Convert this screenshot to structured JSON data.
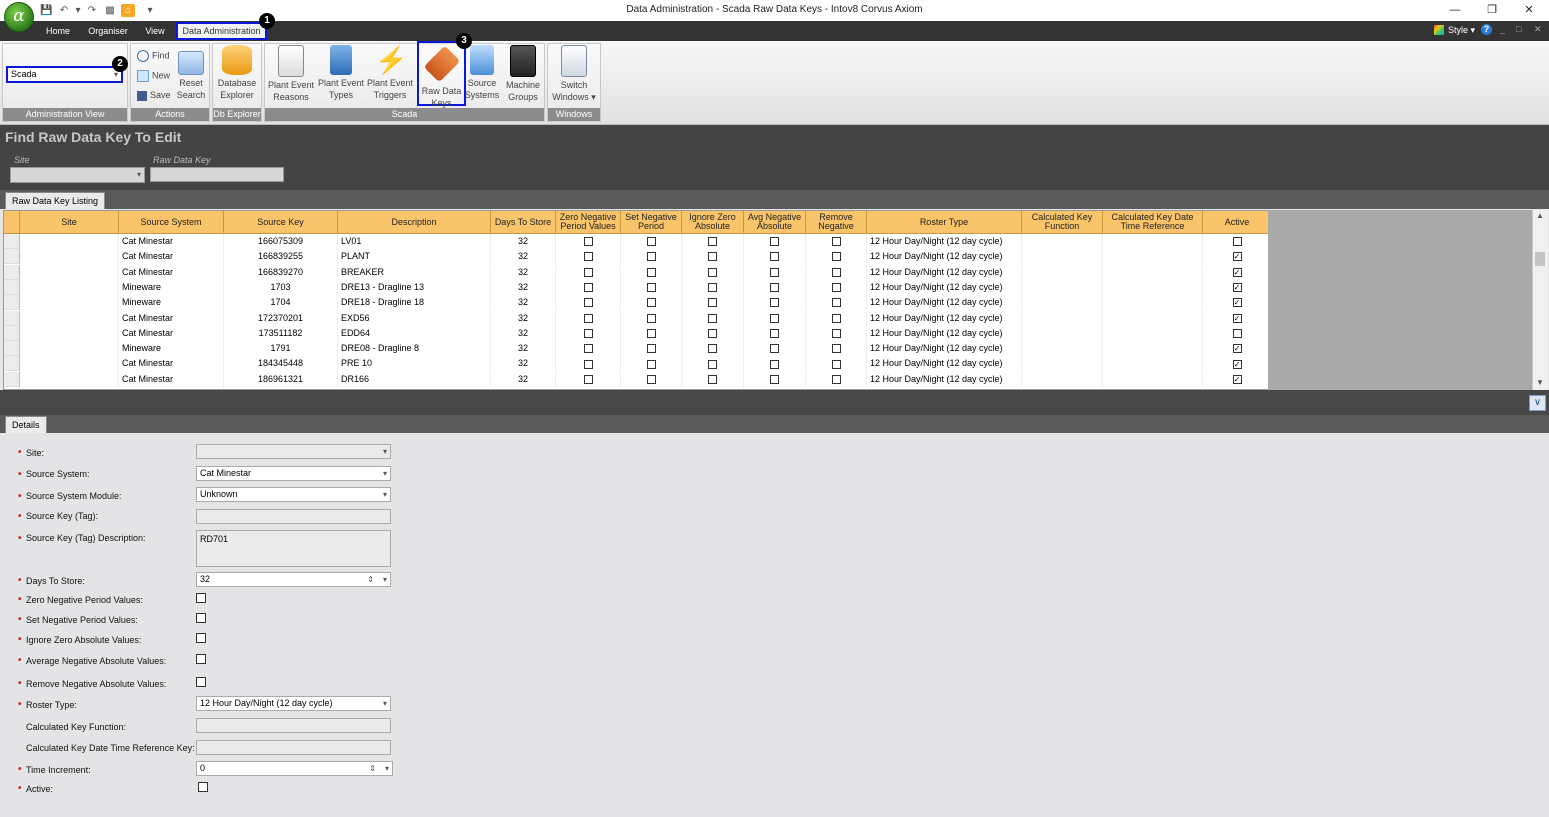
{
  "window": {
    "title": "Data Administration - Scada Raw Data Keys - Intov8 Corvus Axiom",
    "app_logo": "α",
    "style_label": "Style",
    "help_icon": "?",
    "minimize": "—",
    "restore": "❐",
    "close": "✕"
  },
  "ribbon": {
    "tabs": [
      "Home",
      "Organiser",
      "View",
      "Data Administration"
    ],
    "admin_view_value": "Scada",
    "groups": {
      "admin_view": "Administration View",
      "actions": "Actions",
      "db_explorer": "Db Explorer",
      "scada": "Scada",
      "windows": "Windows"
    },
    "actions": {
      "find": "Find",
      "new": "New",
      "save": "Save",
      "reset_line1": "Reset",
      "reset_line2": "Search"
    },
    "buttons": {
      "database_explorer": [
        "Database",
        "Explorer"
      ],
      "plant_event_reasons": [
        "Plant Event",
        "Reasons"
      ],
      "plant_event_types": [
        "Plant Event",
        "Types"
      ],
      "plant_event_triggers": [
        "Plant Event",
        "Triggers"
      ],
      "raw_data_keys": [
        "Raw Data",
        "Keys"
      ],
      "source_systems": [
        "Source",
        "Systems"
      ],
      "machine_groups": [
        "Machine",
        "Groups"
      ],
      "switch_windows": [
        "Switch",
        "Windows ▾"
      ]
    }
  },
  "callouts": [
    "1",
    "2",
    "3"
  ],
  "find_panel": {
    "title": "Find Raw Data Key To Edit",
    "site_label": "Site",
    "raw_data_key_label": "Raw Data Key"
  },
  "listing": {
    "tab": "Raw Data Key Listing",
    "columns": [
      "Site",
      "Source System",
      "Source Key",
      "Description",
      "Days To Store",
      "Zero Negative Period Values",
      "Set Negative Period",
      "Ignore Zero Absolute",
      "Avg Negative Absolute",
      "Remove Negative",
      "Roster Type",
      "Calculated Key Function",
      "Calculated Key Date Time Reference",
      "Active"
    ],
    "rows": [
      {
        "site": "",
        "source_system": "Cat Minestar",
        "source_key": "166075309",
        "description": "LV01",
        "days": "32",
        "roster": "12 Hour Day/Night (12 day cycle)",
        "active": false
      },
      {
        "site": "",
        "source_system": "Cat Minestar",
        "source_key": "166839255",
        "description": "PLANT",
        "days": "32",
        "roster": "12 Hour Day/Night (12 day cycle)",
        "active": true
      },
      {
        "site": "",
        "source_system": "Cat Minestar",
        "source_key": "166839270",
        "description": "BREAKER",
        "days": "32",
        "roster": "12 Hour Day/Night (12 day cycle)",
        "active": true
      },
      {
        "site": "",
        "source_system": "Mineware",
        "source_key": "1703",
        "description": "DRE13 - Dragline 13",
        "days": "32",
        "roster": "12 Hour Day/Night (12 day cycle)",
        "active": true
      },
      {
        "site": "",
        "source_system": "Mineware",
        "source_key": "1704",
        "description": "DRE18 - Dragline 18",
        "days": "32",
        "roster": "12 Hour Day/Night (12 day cycle)",
        "active": true
      },
      {
        "site": "",
        "source_system": "Cat Minestar",
        "source_key": "172370201",
        "description": "EXD56",
        "days": "32",
        "roster": "12 Hour Day/Night (12 day cycle)",
        "active": true
      },
      {
        "site": "",
        "source_system": "Cat Minestar",
        "source_key": "173511182",
        "description": "EDD64",
        "days": "32",
        "roster": "12 Hour Day/Night (12 day cycle)",
        "active": false
      },
      {
        "site": "",
        "source_system": "Mineware",
        "source_key": "1791",
        "description": "DRE08 - Dragline 8",
        "days": "32",
        "roster": "12 Hour Day/Night (12 day cycle)",
        "active": true
      },
      {
        "site": "",
        "source_system": "Cat Minestar",
        "source_key": "184345448",
        "description": "PRE 10",
        "days": "32",
        "roster": "12 Hour Day/Night (12 day cycle)",
        "active": true
      },
      {
        "site": "",
        "source_system": "Cat Minestar",
        "source_key": "186961321",
        "description": "DR166",
        "days": "32",
        "roster": "12 Hour Day/Night (12 day cycle)",
        "active": true
      }
    ]
  },
  "details": {
    "tab": "Details",
    "labels": {
      "site": "Site:",
      "source_system": "Source System:",
      "source_system_module": "Source System Module:",
      "source_key": "Source Key (Tag):",
      "source_key_desc": "Source Key (Tag) Description:",
      "days_to_store": "Days To Store:",
      "zero_neg": "Zero Negative Period Values:",
      "set_neg": "Set Negative Period Values:",
      "ignore_zero": "Ignore Zero Absolute Values:",
      "avg_neg": "Average Negative Absolute Values:",
      "remove_neg": "Remove Negative Absolute Values:",
      "roster_type": "Roster Type:",
      "calc_fn": "Calculated Key Function:",
      "calc_ref": "Calculated Key Date Time Reference Key:",
      "time_increment": "Time Increment:",
      "active": "Active:"
    },
    "values": {
      "source_system": "Cat Minestar",
      "source_system_module": "Unknown",
      "source_key_desc": "RD701",
      "days_to_store": "32",
      "roster_type": "12 Hour Day/Night (12 day cycle)",
      "time_increment": "0"
    }
  }
}
